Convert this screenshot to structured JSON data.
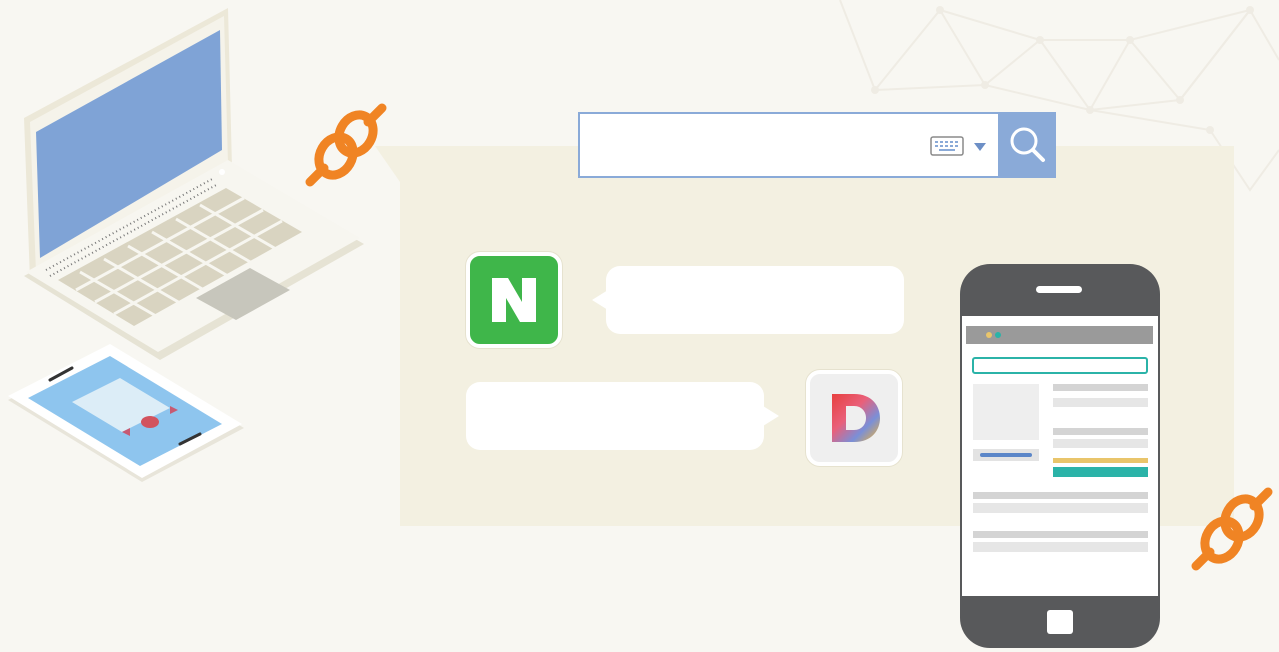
{
  "search": {
    "value": "",
    "placeholder": ""
  },
  "icons": {
    "naver": "naver-n-app-icon",
    "daum": "daum-d-app-icon",
    "keyboard": "keyboard-icon",
    "search": "magnifier-icon",
    "link": "chain-link-icon"
  },
  "colors": {
    "background": "#f8f7f2",
    "panel": "#f3f0e1",
    "accent_blue": "#8aaad8",
    "naver_green": "#3fb64a",
    "link_orange": "#f08424",
    "phone_body": "#58595b",
    "laptop_screen": "#7fa3d6"
  }
}
